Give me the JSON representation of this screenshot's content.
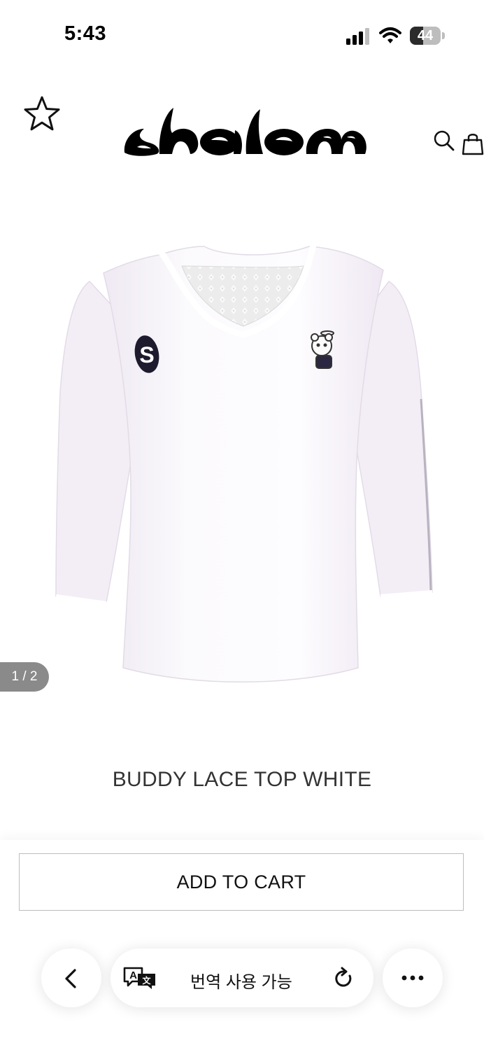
{
  "status_bar": {
    "time": "5:43",
    "battery_level": "44",
    "signal_icon": "cellular-signal-icon",
    "wifi_icon": "wifi-icon"
  },
  "header": {
    "logo_text": "shalom",
    "favorite_icon": "star-outline-icon",
    "search_icon": "search-icon",
    "cart_icon": "shopping-bag-icon"
  },
  "product": {
    "image_counter": "1 / 2",
    "title": "BUDDY LACE TOP WHITE",
    "emblem_letter": "S"
  },
  "actions": {
    "add_to_cart_label": "ADD TO CART"
  },
  "browser_bar": {
    "translate_label": "번역 사용 가능",
    "back_icon": "chevron-left-icon",
    "translate_icon": "translate-icon",
    "reload_icon": "reload-icon",
    "more_icon": "more-dots-icon"
  }
}
